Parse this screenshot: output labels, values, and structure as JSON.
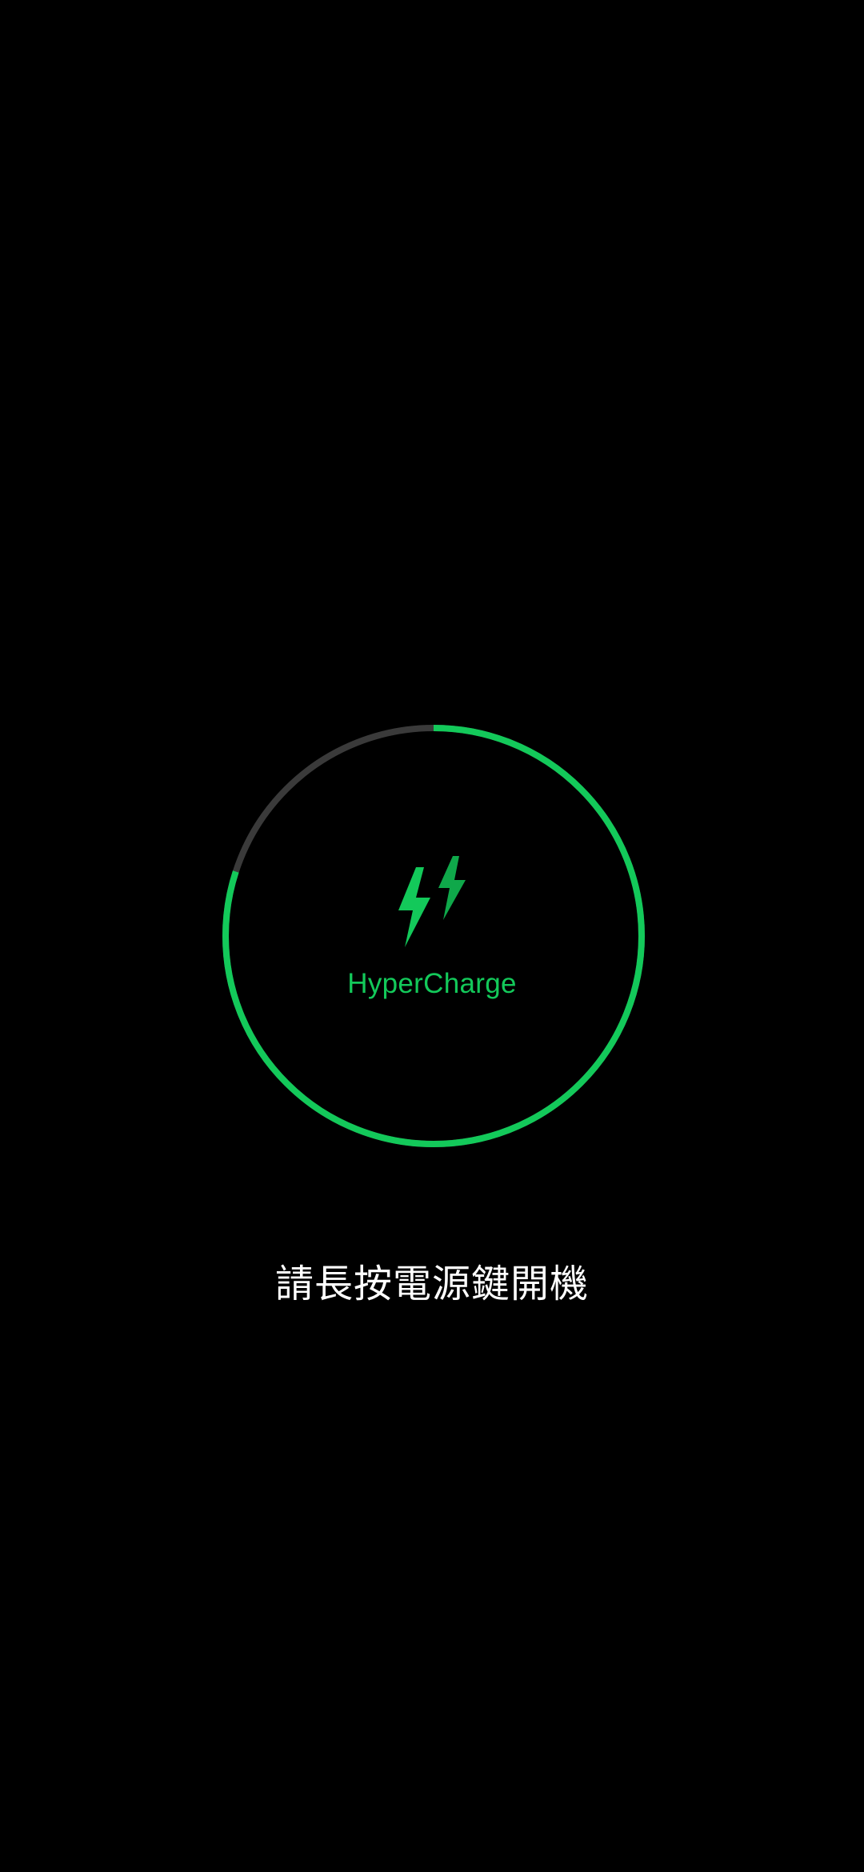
{
  "charge_status": {
    "brand_label": "HyperCharge",
    "charge_progress_fraction": 0.8,
    "icon": "lightning-bolt-icon",
    "colors": {
      "accent": "#13c95a",
      "accent_dark": "#0fa84a",
      "track": "#3a3a3a",
      "background": "#000000",
      "text": "#ffffff"
    }
  },
  "instruction_text": "請長按電源鍵開機"
}
